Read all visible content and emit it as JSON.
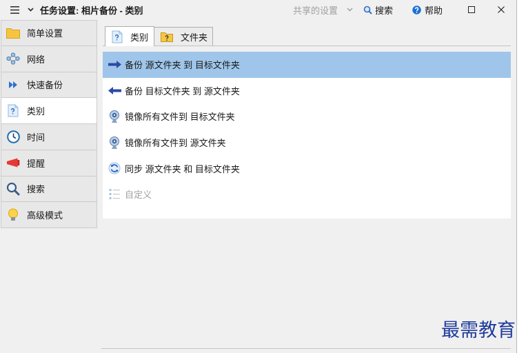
{
  "window": {
    "title": "任务设置: 相片备份 - 类别",
    "menu_icon": "hamburger-menu-icon",
    "dropdown_icon": "chevron-down-icon",
    "shared_settings": {
      "label": "共享的设置",
      "icon": "chevron-down-icon",
      "enabled": false
    },
    "search": {
      "label": "搜索",
      "icon": "search-icon"
    },
    "help": {
      "label": "帮助",
      "icon": "help-circle-icon"
    },
    "maximize_icon": "maximize-icon",
    "close_icon": "close-icon"
  },
  "sidebar": {
    "items": [
      {
        "label": "简单设置",
        "icon": "folder-icon",
        "selected": false
      },
      {
        "label": "网络",
        "icon": "network-icon",
        "selected": false
      },
      {
        "label": "快速备份",
        "icon": "fast-forward-icon",
        "selected": false
      },
      {
        "label": "类别",
        "icon": "help-document-icon",
        "selected": true
      },
      {
        "label": "时间",
        "icon": "clock-icon",
        "selected": false
      },
      {
        "label": "提醒",
        "icon": "megaphone-icon",
        "selected": false
      },
      {
        "label": "搜索",
        "icon": "magnifier-icon",
        "selected": false
      },
      {
        "label": "高级模式",
        "icon": "lightbulb-icon",
        "selected": false
      }
    ]
  },
  "tabs": [
    {
      "label": "类别",
      "icon": "help-document-icon",
      "selected": true
    },
    {
      "label": "文件夹",
      "icon": "help-folder-icon",
      "selected": false
    }
  ],
  "category_list": [
    {
      "label": "备份 源文件夹 到 目标文件夹",
      "icon": "arrow-right-icon",
      "selected": true,
      "enabled": true
    },
    {
      "label": "备份 目标文件夹 到 源文件夹",
      "icon": "arrow-left-icon",
      "selected": false,
      "enabled": true
    },
    {
      "label": "镜像所有文件到 目标文件夹",
      "icon": "mirror-icon",
      "selected": false,
      "enabled": true
    },
    {
      "label": "镜像所有文件到 源文件夹",
      "icon": "mirror-icon",
      "selected": false,
      "enabled": true
    },
    {
      "label": "同步 源文件夹 和 目标文件夹",
      "icon": "sync-icon",
      "selected": false,
      "enabled": true
    },
    {
      "label": "自定义",
      "icon": "custom-list-icon",
      "selected": false,
      "enabled": false
    }
  ],
  "watermark": "最需教育",
  "colors": {
    "window_bg": "#f0f0f0",
    "sidebar_bg": "#e8e8e8",
    "selection": "#9fc6ea",
    "watermark": "#1f3a9b",
    "disabled_text": "#a0a0a0"
  }
}
